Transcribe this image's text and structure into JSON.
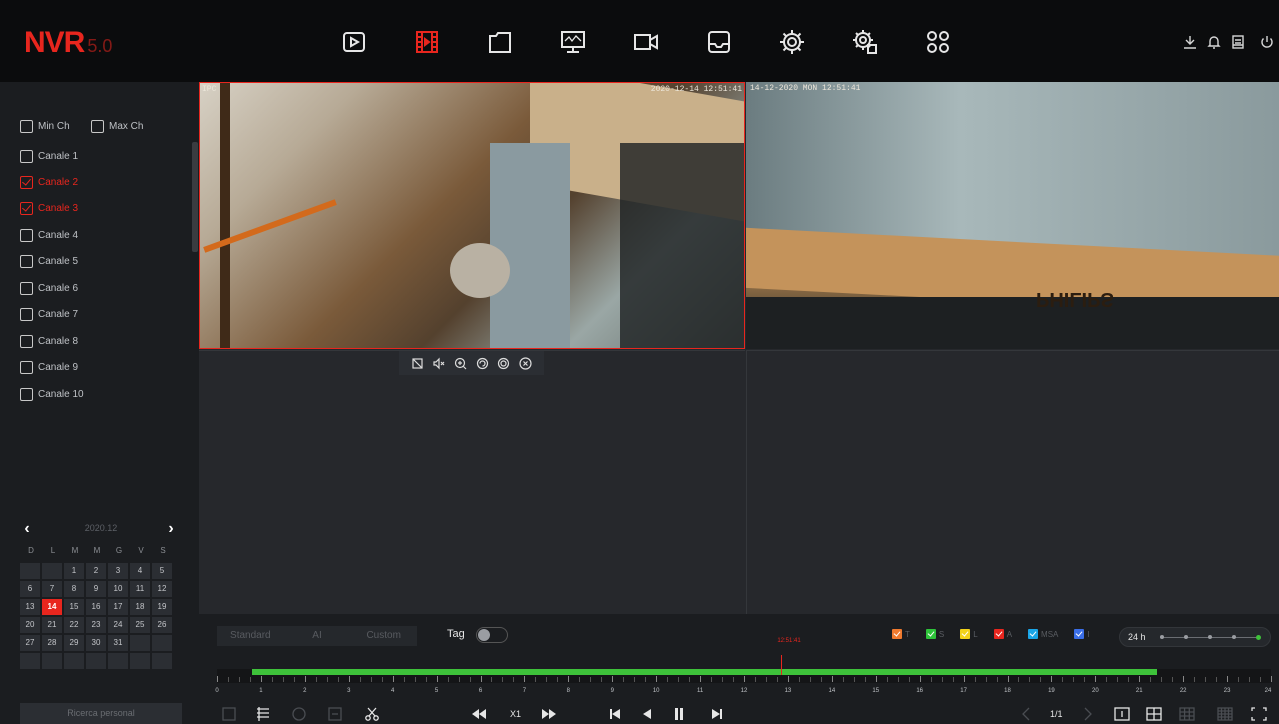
{
  "app": {
    "logo": "NVR",
    "version": "5.0"
  },
  "nav": [
    {
      "name": "playback-icon"
    },
    {
      "name": "video-clip-icon",
      "active": true
    },
    {
      "name": "file-icon"
    },
    {
      "name": "monitor-icon"
    },
    {
      "name": "camera-icon"
    },
    {
      "name": "storage-icon"
    },
    {
      "name": "settings-icon"
    },
    {
      "name": "system-settings-icon"
    },
    {
      "name": "apps-grid-icon"
    }
  ],
  "header_right": [
    "download-icon",
    "bell-icon",
    "backup-icon",
    "power-icon"
  ],
  "channels": {
    "min_label": "Min Ch",
    "max_label": "Max Ch",
    "items": [
      {
        "label": "Canale 1",
        "checked": false
      },
      {
        "label": "Canale 2",
        "checked": true
      },
      {
        "label": "Canale 3",
        "checked": true
      },
      {
        "label": "Canale 4",
        "checked": false
      },
      {
        "label": "Canale 5",
        "checked": false
      },
      {
        "label": "Canale 6",
        "checked": false
      },
      {
        "label": "Canale 7",
        "checked": false
      },
      {
        "label": "Canale 8",
        "checked": false
      },
      {
        "label": "Canale 9",
        "checked": false
      },
      {
        "label": "Canale 10",
        "checked": false
      }
    ]
  },
  "calendar": {
    "month": "2020.12",
    "weekdays": [
      "D",
      "L",
      "M",
      "M",
      "G",
      "V",
      "S"
    ],
    "leading_blanks": 2,
    "days": 31,
    "today": 14
  },
  "search_button": "Ricerca personal",
  "cameras": {
    "cam1_osd_left": "IPC",
    "cam1_osd": "2020-12-14 12:51:41",
    "cam2_osd": "14-12-2020 MON 12:51:41",
    "cam2_brand": "PHILIPS"
  },
  "modes": [
    "Standard",
    "AI",
    "Custom"
  ],
  "tag_label": "Tag",
  "legend": [
    {
      "label": "T",
      "color": "#f07a2e"
    },
    {
      "label": "S",
      "color": "#2ec43a"
    },
    {
      "label": "L",
      "color": "#f3d21a"
    },
    {
      "label": "A",
      "color": "#e8261e"
    },
    {
      "label": "MSA",
      "color": "#1aa6e8"
    },
    {
      "label": "I",
      "color": "#3a6ee8"
    }
  ],
  "zoom_label": "24 h",
  "timeline": {
    "hours": [
      "0",
      "1",
      "2",
      "3",
      "4",
      "5",
      "6",
      "7",
      "8",
      "9",
      "10",
      "11",
      "12",
      "13",
      "14",
      "15",
      "16",
      "17",
      "18",
      "19",
      "20",
      "21",
      "22",
      "23",
      "24"
    ],
    "record_start": 0.8,
    "record_end": 21.4,
    "cursor": 12.85,
    "cursor_label": "12:51:41"
  },
  "playback": {
    "speed": "X1",
    "page": "1/1"
  }
}
